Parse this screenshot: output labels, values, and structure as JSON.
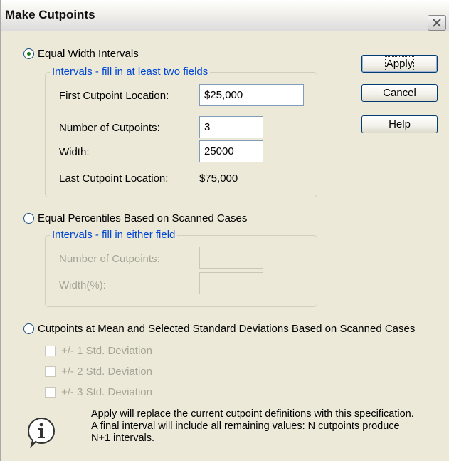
{
  "window": {
    "title": "Make Cutpoints",
    "close_icon": "close-icon"
  },
  "options": {
    "equal_width": {
      "label": "Equal Width Intervals",
      "selected": true
    },
    "equal_percentiles": {
      "label": "Equal Percentiles Based on Scanned Cases",
      "selected": false
    },
    "mean_sd": {
      "label": "Cutpoints at Mean and Selected Standard Deviations Based on Scanned Cases",
      "selected": false
    }
  },
  "equal_width_group": {
    "legend": "Intervals - fill in at least two fields",
    "first_cutpoint_label": "First Cutpoint Location:",
    "first_cutpoint_value": "$25,000",
    "num_cutpoints_label": "Number of Cutpoints:",
    "num_cutpoints_value": "3",
    "width_label": "Width:",
    "width_value": "25000",
    "last_cutpoint_label": "Last Cutpoint Location:",
    "last_cutpoint_value": "$75,000"
  },
  "percentile_group": {
    "legend": "Intervals - fill in either field",
    "num_cutpoints_label": "Number of Cutpoints:",
    "width_label": "Width(%):"
  },
  "std_dev_options": [
    {
      "label": "+/- 1 Std. Deviation",
      "checked": false
    },
    {
      "label": "+/- 2 Std. Deviation",
      "checked": false
    },
    {
      "label": "+/- 3 Std. Deviation",
      "checked": false
    }
  ],
  "buttons": {
    "apply": "Apply",
    "cancel": "Cancel",
    "help": "Help"
  },
  "info": {
    "icon": "info-icon",
    "lines": [
      "Apply will replace the current cutpoint definitions with this specification.",
      "A final interval will include all remaining values: N cutpoints produce",
      "N+1 intervals."
    ]
  },
  "colors": {
    "legend_blue": "#0046d5",
    "dialog_bg": "#ece9d8",
    "disabled_text": "#a5a597"
  }
}
